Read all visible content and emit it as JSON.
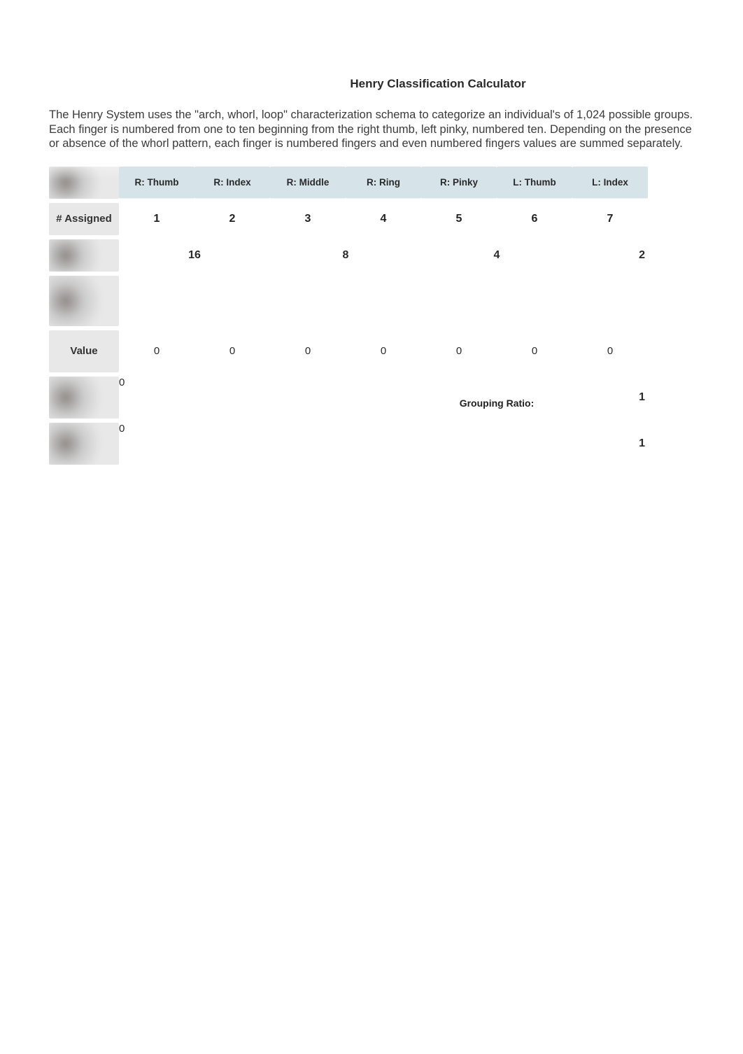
{
  "title": "Henry Classification Calculator",
  "description": "The Henry System uses the \"arch, whorl, loop\" characterization schema to categorize an individual's of 1,024 possible groups.  Each finger is numbered from one to ten beginning from the right thumb, left pinky, numbered ten. Depending on the presence or absence of the whorl pattern, each finger is numbered fingers and even numbered fingers values are summed separately.",
  "columns": [
    "R:  Thumb",
    "R:  Index",
    "R:  Middle",
    "R:   Ring",
    "R:  Pinky",
    "L:  Thumb",
    "L:  Index"
  ],
  "row_labels": {
    "assigned": "# Assigned",
    "value": "Value"
  },
  "assigned": [
    "1",
    "2",
    "3",
    "4",
    "5",
    "6",
    "7"
  ],
  "weights": [
    "16",
    "8",
    "4",
    "2"
  ],
  "values": [
    "0",
    "0",
    "0",
    "0",
    "0",
    "0",
    "0"
  ],
  "sum_top": "0",
  "sum_bottom": "0",
  "grouping_label": "Grouping Ratio:",
  "ratio_top": "1",
  "ratio_bottom": "1"
}
